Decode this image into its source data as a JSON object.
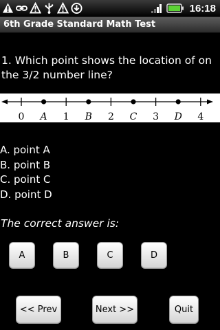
{
  "status_bar": {
    "time": "16:18",
    "icons": [
      "warning-icon",
      "link-icon",
      "alert-icon",
      "usb-icon",
      "alert-icon",
      "download-icon",
      "signal-icon",
      "battery-icon"
    ]
  },
  "app": {
    "title": "6th Grade Standard Math Test"
  },
  "question": {
    "text": "1. Which point shows the location of on the 3/2 number line?"
  },
  "number_line": {
    "tick_labels": [
      "0",
      "A",
      "1",
      "B",
      "2",
      "C",
      "3",
      "D",
      "4"
    ],
    "line_color": "#000000",
    "background": "#ffffff"
  },
  "options": [
    {
      "letter": "A",
      "text": "A. point A"
    },
    {
      "letter": "B",
      "text": "B. point B"
    },
    {
      "letter": "C",
      "text": "C. point C"
    },
    {
      "letter": "D",
      "text": "D. point D"
    }
  ],
  "answer_prompt": "The correct answer is:",
  "answer_buttons": [
    "A",
    "B",
    "C",
    "D"
  ],
  "navigation": {
    "prev_label": "<< Prev",
    "next_label": "Next >>",
    "quit_label": "Quit"
  },
  "colors": {
    "background": "#000000",
    "text": "#ffffff",
    "button_top": "#ffffff",
    "button_bottom": "#d4d4d4"
  }
}
